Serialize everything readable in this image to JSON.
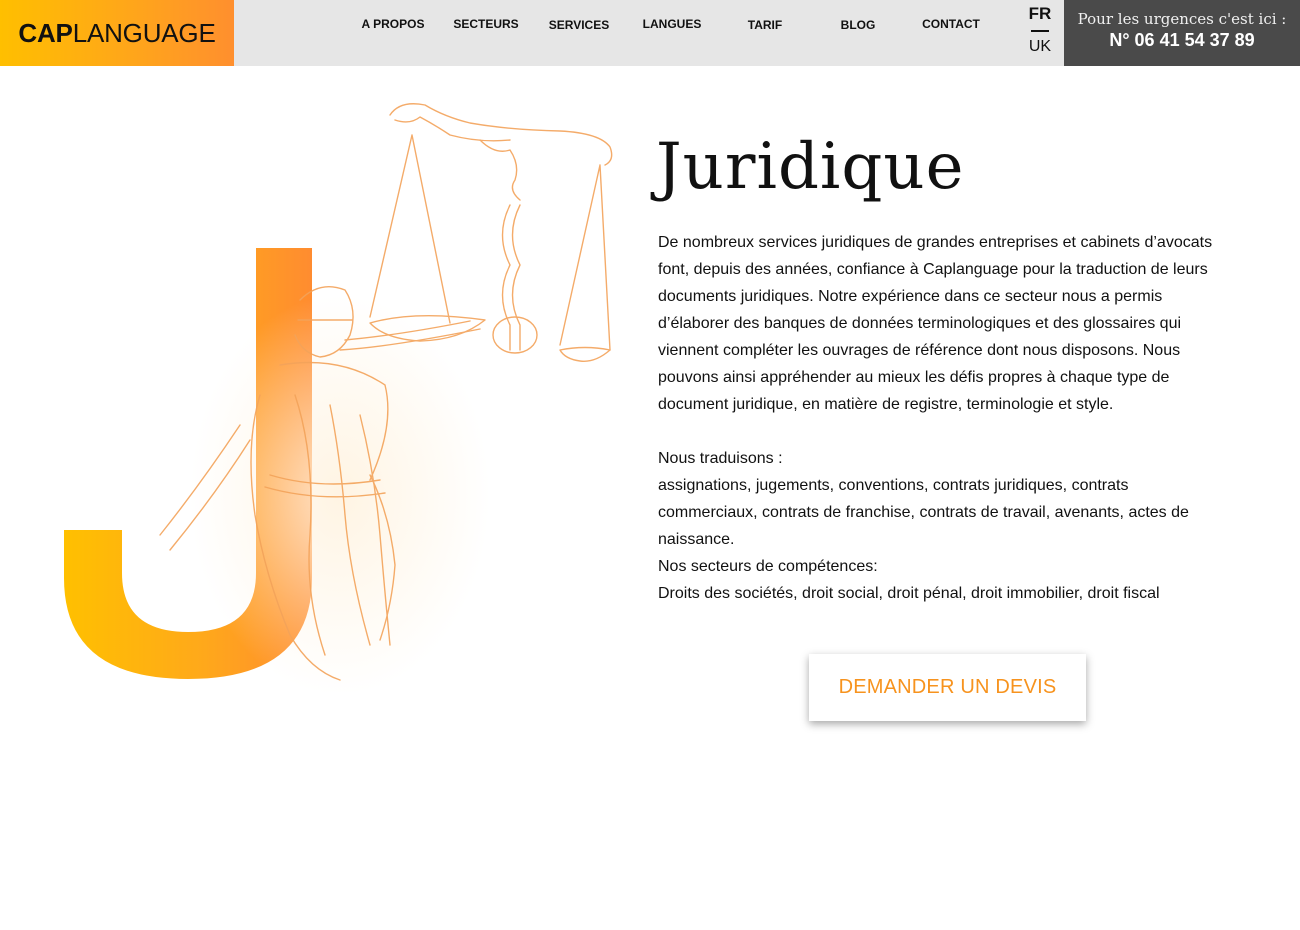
{
  "brand": {
    "bold": "CAP",
    "light": "LANGUAGE",
    "gradient_from": "#ffbf00",
    "gradient_to": "#ff8f2e"
  },
  "nav": {
    "items": [
      {
        "label": "A PROPOS"
      },
      {
        "label": "SECTEURS"
      },
      {
        "label": "SERVICES"
      },
      {
        "label": "LANGUES"
      },
      {
        "label": "TARIF"
      },
      {
        "label": "BLOG"
      },
      {
        "label": "CONTACT"
      }
    ]
  },
  "language": {
    "current": "FR",
    "other": "UK"
  },
  "urgent": {
    "label": "Pour les urgences c'est ici :",
    "phone": "N° 06 41 54 37 89",
    "background": "#4a4a4a"
  },
  "page": {
    "title": "Juridique",
    "intro": "De nombreux services juridiques de grandes entreprises et cabinets d’avocats font, depuis des années, confiance à Caplanguage pour la traduction de leurs documents juridiques. Notre expérience dans ce secteur nous a permis d’élaborer des banques de données terminologiques et des glossaires qui viennent compléter les ouvrages de référence dont nous disposons. Nous pouvons ainsi appréhender au mieux les défis propres à chaque type de document juridique, en matière de registre, terminologie et style.",
    "translate_heading": "Nous traduisons :",
    "translate_list": "assignations, jugements, conventions, contrats juridiques, contrats commerciaux, contrats de franchise, contrats de travail, avenants, actes de naissance.",
    "sectors_heading": "Nos secteurs de compétences:",
    "sectors_list": "Droits des sociétés, droit social, droit pénal, droit immobilier, droit fiscal",
    "cta_label": "DEMANDER UN DEVIS",
    "accent": "#f7931e"
  },
  "illustration": {
    "letter": "J",
    "subject": "lady-justice-scales"
  }
}
